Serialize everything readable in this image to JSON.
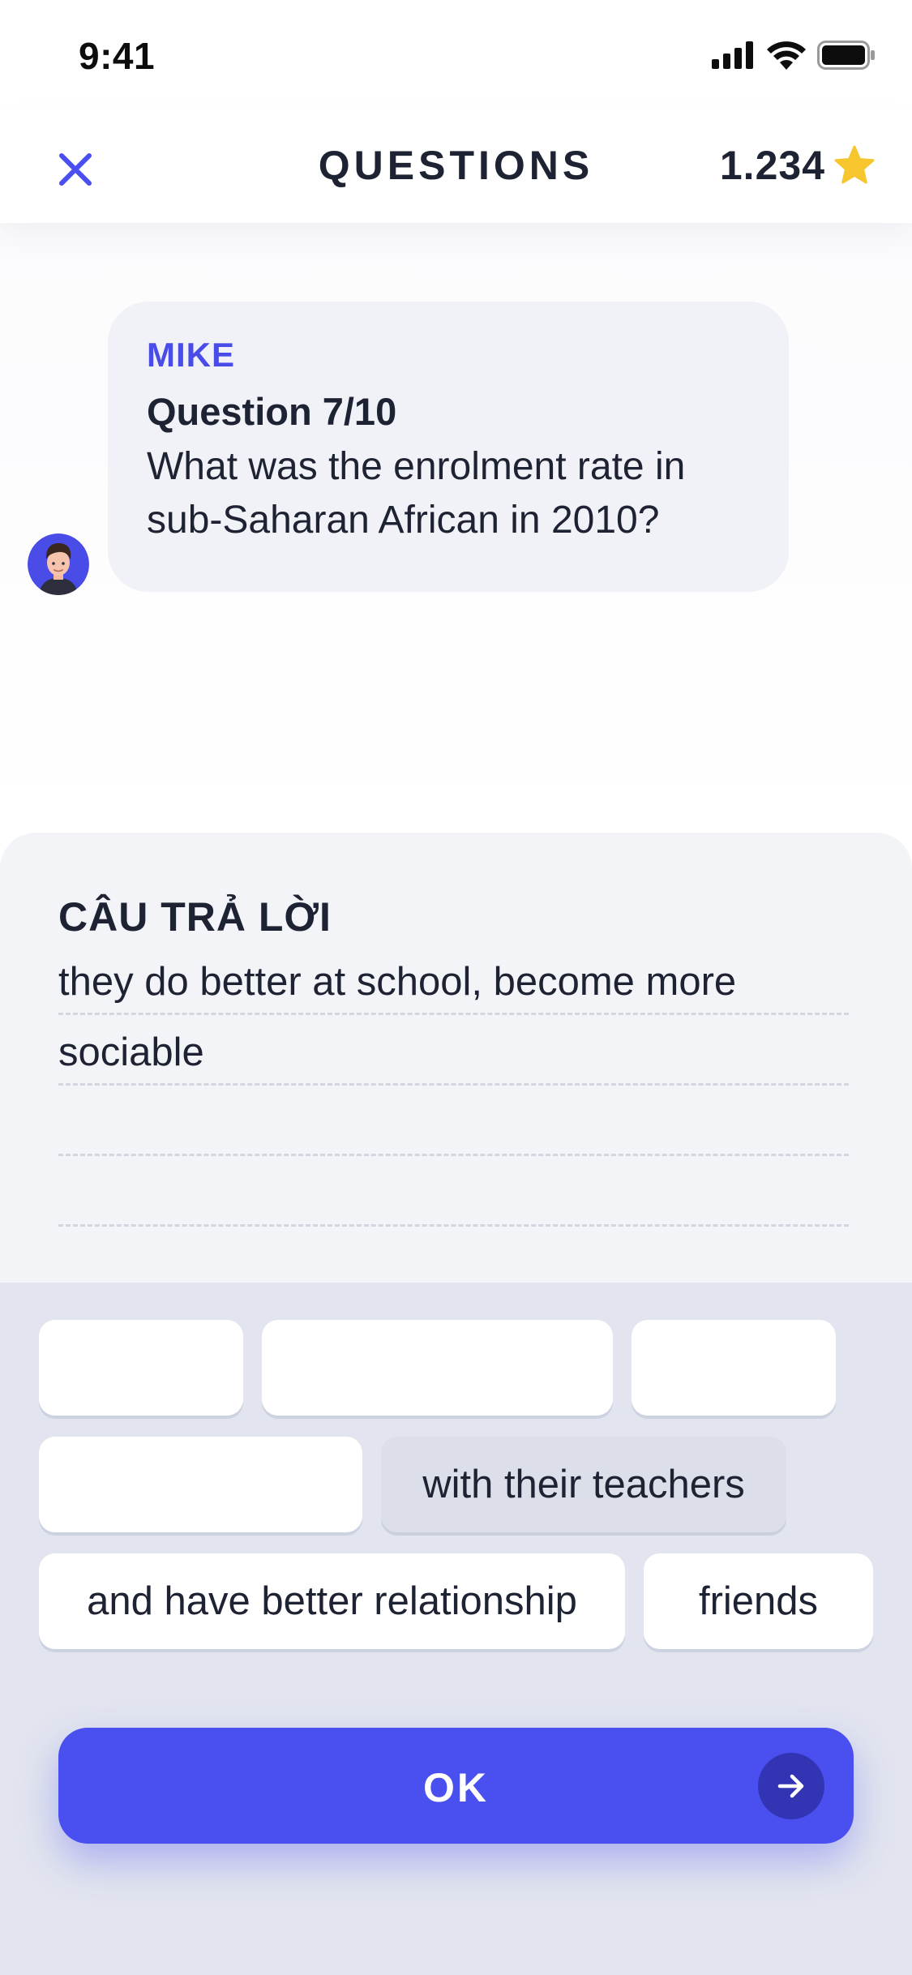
{
  "status_bar": {
    "time": "9:41"
  },
  "header": {
    "close_icon": "close-icon",
    "title": "QUESTIONS",
    "score": "1.234",
    "score_icon": "star-icon"
  },
  "chat": {
    "avatar_icon": "user-avatar",
    "sender": "MIKE",
    "question_number": "Question 7/10",
    "question_text": "What was the enrolment rate in sub-Saharan African in 2010?"
  },
  "answer": {
    "title": "CÂU TRẢ LỜI",
    "lines": [
      "they do better at school, become more",
      "sociable",
      "",
      ""
    ]
  },
  "word_bank": {
    "chips": [
      {
        "label": "",
        "used": false
      },
      {
        "label": "",
        "used": false
      },
      {
        "label": "",
        "used": false
      },
      {
        "label": "",
        "used": false
      },
      {
        "label": "with their teachers",
        "used": true
      },
      {
        "label": "and have better relationship",
        "used": false
      },
      {
        "label": "friends",
        "used": false
      }
    ]
  },
  "ok_button": {
    "label": "OK",
    "icon": "arrow-right-icon"
  },
  "colors": {
    "accent": "#4a4ff0",
    "sender": "#4a4ce8",
    "star": "#f7c62f",
    "text": "#1e2333"
  }
}
